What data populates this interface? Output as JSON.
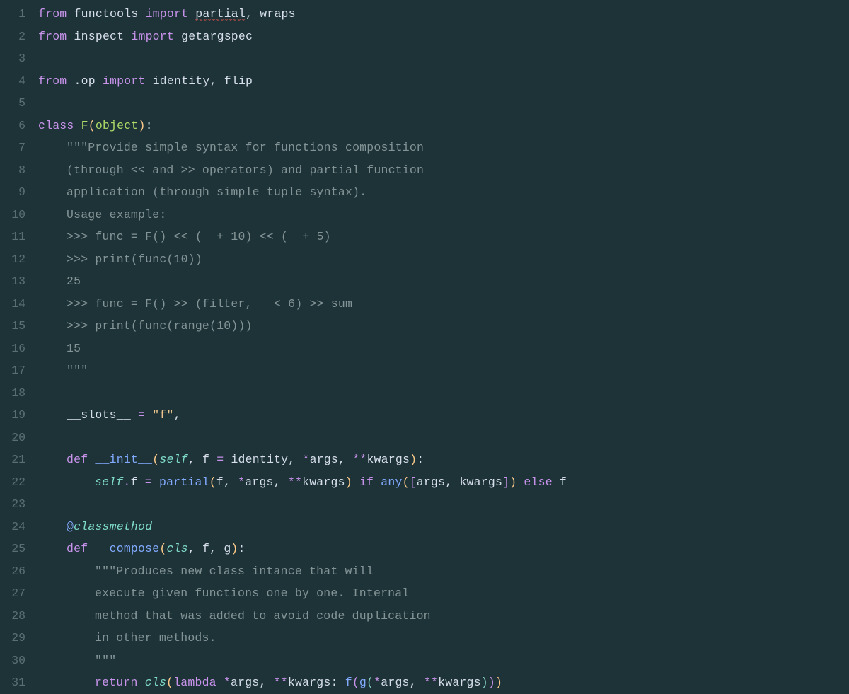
{
  "colors": {
    "background": "#1e3338",
    "gutter": "#5a6f74",
    "keyword": "#c792ea",
    "function": "#82aaff",
    "string_doc": "#839496",
    "string": "#ecc48d",
    "number": "#f78c6c",
    "paren": "#ffcb8b",
    "self": "#7fdbca",
    "type": "#addb67"
  },
  "file_language": "python",
  "line_start": 1,
  "line_end": 31,
  "lines": [
    {
      "n": 1,
      "indent": 0,
      "tokens": [
        [
          "kw",
          "from"
        ],
        [
          "sp",
          " "
        ],
        [
          "id",
          "functools"
        ],
        [
          "sp",
          " "
        ],
        [
          "kw",
          "import"
        ],
        [
          "sp",
          " "
        ],
        [
          "sq",
          "partial"
        ],
        [
          "comma",
          ","
        ],
        [
          "sp",
          " "
        ],
        [
          "id",
          "wraps"
        ]
      ]
    },
    {
      "n": 2,
      "indent": 0,
      "tokens": [
        [
          "kw",
          "from"
        ],
        [
          "sp",
          " "
        ],
        [
          "id",
          "inspect"
        ],
        [
          "sp",
          " "
        ],
        [
          "kw",
          "import"
        ],
        [
          "sp",
          " "
        ],
        [
          "id",
          "getargspec"
        ]
      ]
    },
    {
      "n": 3,
      "indent": 0,
      "tokens": []
    },
    {
      "n": 4,
      "indent": 0,
      "tokens": [
        [
          "kw",
          "from"
        ],
        [
          "sp",
          " "
        ],
        [
          "id",
          ".op"
        ],
        [
          "sp",
          " "
        ],
        [
          "kw",
          "import"
        ],
        [
          "sp",
          " "
        ],
        [
          "id",
          "identity"
        ],
        [
          "comma",
          ","
        ],
        [
          "sp",
          " "
        ],
        [
          "id",
          "flip"
        ]
      ]
    },
    {
      "n": 5,
      "indent": 0,
      "tokens": []
    },
    {
      "n": 6,
      "indent": 0,
      "tokens": [
        [
          "kw",
          "class"
        ],
        [
          "sp",
          " "
        ],
        [
          "type",
          "F"
        ],
        [
          "p",
          "("
        ],
        [
          "type",
          "object"
        ],
        [
          "p",
          ")"
        ],
        [
          "id",
          ":"
        ]
      ]
    },
    {
      "n": 7,
      "indent": 1,
      "tokens": [
        [
          "str",
          "\"\"\"Provide simple syntax for functions composition"
        ]
      ]
    },
    {
      "n": 8,
      "indent": 1,
      "tokens": [
        [
          "str",
          "(through << and >> operators) and partial function"
        ]
      ]
    },
    {
      "n": 9,
      "indent": 1,
      "tokens": [
        [
          "str",
          "application (through simple tuple syntax)."
        ]
      ]
    },
    {
      "n": 10,
      "indent": 1,
      "tokens": [
        [
          "str",
          "Usage example:"
        ]
      ]
    },
    {
      "n": 11,
      "indent": 1,
      "tokens": [
        [
          "str",
          ">>> func = F() << (_ + 10) << (_ + 5)"
        ]
      ]
    },
    {
      "n": 12,
      "indent": 1,
      "tokens": [
        [
          "str",
          ">>> print(func(10))"
        ]
      ]
    },
    {
      "n": 13,
      "indent": 1,
      "tokens": [
        [
          "str",
          "25"
        ]
      ]
    },
    {
      "n": 14,
      "indent": 1,
      "tokens": [
        [
          "str",
          ">>> func = F() >> (filter, _ < 6) >> sum"
        ]
      ]
    },
    {
      "n": 15,
      "indent": 1,
      "tokens": [
        [
          "str",
          ">>> print(func(range(10)))"
        ]
      ]
    },
    {
      "n": 16,
      "indent": 1,
      "tokens": [
        [
          "str",
          "15"
        ]
      ]
    },
    {
      "n": 17,
      "indent": 1,
      "tokens": [
        [
          "str",
          "\"\"\""
        ]
      ]
    },
    {
      "n": 18,
      "indent": 0,
      "tokens": []
    },
    {
      "n": 19,
      "indent": 1,
      "tokens": [
        [
          "id",
          "__slots__"
        ],
        [
          "sp",
          " "
        ],
        [
          "op",
          "="
        ],
        [
          "sp",
          " "
        ],
        [
          "str2",
          "\"f\""
        ],
        [
          "comma",
          ","
        ]
      ]
    },
    {
      "n": 20,
      "indent": 0,
      "tokens": []
    },
    {
      "n": 21,
      "indent": 1,
      "tokens": [
        [
          "kw",
          "def"
        ],
        [
          "sp",
          " "
        ],
        [
          "fn",
          "__init__"
        ],
        [
          "p",
          "("
        ],
        [
          "self",
          "self"
        ],
        [
          "comma",
          ","
        ],
        [
          "sp",
          " "
        ],
        [
          "arg",
          "f"
        ],
        [
          "sp",
          " "
        ],
        [
          "op",
          "="
        ],
        [
          "sp",
          " "
        ],
        [
          "id",
          "identity"
        ],
        [
          "comma",
          ","
        ],
        [
          "sp",
          " "
        ],
        [
          "op",
          "*"
        ],
        [
          "arg",
          "args"
        ],
        [
          "comma",
          ","
        ],
        [
          "sp",
          " "
        ],
        [
          "op",
          "**"
        ],
        [
          "arg",
          "kwargs"
        ],
        [
          "p",
          ")"
        ],
        [
          "id",
          ":"
        ]
      ]
    },
    {
      "n": 22,
      "indent": 2,
      "tokens": [
        [
          "self",
          "self"
        ],
        [
          "dot",
          "."
        ],
        [
          "id",
          "f"
        ],
        [
          "sp",
          " "
        ],
        [
          "op",
          "="
        ],
        [
          "sp",
          " "
        ],
        [
          "built",
          "partial"
        ],
        [
          "p",
          "("
        ],
        [
          "id",
          "f"
        ],
        [
          "comma",
          ","
        ],
        [
          "sp",
          " "
        ],
        [
          "op",
          "*"
        ],
        [
          "id",
          "args"
        ],
        [
          "comma",
          ","
        ],
        [
          "sp",
          " "
        ],
        [
          "op",
          "**"
        ],
        [
          "id",
          "kwargs"
        ],
        [
          "p",
          ")"
        ],
        [
          "sp",
          " "
        ],
        [
          "kw",
          "if"
        ],
        [
          "sp",
          " "
        ],
        [
          "built",
          "any"
        ],
        [
          "p",
          "("
        ],
        [
          "p2",
          "["
        ],
        [
          "id",
          "args"
        ],
        [
          "comma",
          ","
        ],
        [
          "sp",
          " "
        ],
        [
          "id",
          "kwargs"
        ],
        [
          "p2",
          "]"
        ],
        [
          "p",
          ")"
        ],
        [
          "sp",
          " "
        ],
        [
          "kw",
          "else"
        ],
        [
          "sp",
          " "
        ],
        [
          "id",
          "f"
        ]
      ]
    },
    {
      "n": 23,
      "indent": 0,
      "tokens": []
    },
    {
      "n": 24,
      "indent": 1,
      "tokens": [
        [
          "dec",
          "@"
        ],
        [
          "cls",
          "classmethod"
        ]
      ]
    },
    {
      "n": 25,
      "indent": 1,
      "tokens": [
        [
          "kw",
          "def"
        ],
        [
          "sp",
          " "
        ],
        [
          "fn",
          "__compose"
        ],
        [
          "p",
          "("
        ],
        [
          "cls",
          "cls"
        ],
        [
          "comma",
          ","
        ],
        [
          "sp",
          " "
        ],
        [
          "arg",
          "f"
        ],
        [
          "comma",
          ","
        ],
        [
          "sp",
          " "
        ],
        [
          "arg",
          "g"
        ],
        [
          "p",
          ")"
        ],
        [
          "id",
          ":"
        ]
      ]
    },
    {
      "n": 26,
      "indent": 2,
      "tokens": [
        [
          "str",
          "\"\"\"Produces new class intance that will"
        ]
      ]
    },
    {
      "n": 27,
      "indent": 2,
      "tokens": [
        [
          "str",
          "execute given functions one by one. Internal"
        ]
      ]
    },
    {
      "n": 28,
      "indent": 2,
      "tokens": [
        [
          "str",
          "method that was added to avoid code duplication"
        ]
      ]
    },
    {
      "n": 29,
      "indent": 2,
      "tokens": [
        [
          "str",
          "in other methods."
        ]
      ]
    },
    {
      "n": 30,
      "indent": 2,
      "tokens": [
        [
          "str",
          "\"\"\""
        ]
      ]
    },
    {
      "n": 31,
      "indent": 2,
      "tokens": [
        [
          "kw",
          "return"
        ],
        [
          "sp",
          " "
        ],
        [
          "cls",
          "cls"
        ],
        [
          "p",
          "("
        ],
        [
          "kw",
          "lambda"
        ],
        [
          "sp",
          " "
        ],
        [
          "op",
          "*"
        ],
        [
          "arg",
          "args"
        ],
        [
          "comma",
          ","
        ],
        [
          "sp",
          " "
        ],
        [
          "op",
          "**"
        ],
        [
          "arg",
          "kwargs"
        ],
        [
          "id",
          ":"
        ],
        [
          "sp",
          " "
        ],
        [
          "built",
          "f"
        ],
        [
          "p2",
          "("
        ],
        [
          "built",
          "g"
        ],
        [
          "p3",
          "("
        ],
        [
          "op",
          "*"
        ],
        [
          "id",
          "args"
        ],
        [
          "comma",
          ","
        ],
        [
          "sp",
          " "
        ],
        [
          "op",
          "**"
        ],
        [
          "id",
          "kwargs"
        ],
        [
          "p3",
          ")"
        ],
        [
          "p2",
          ")"
        ],
        [
          "p",
          ")"
        ]
      ]
    }
  ]
}
